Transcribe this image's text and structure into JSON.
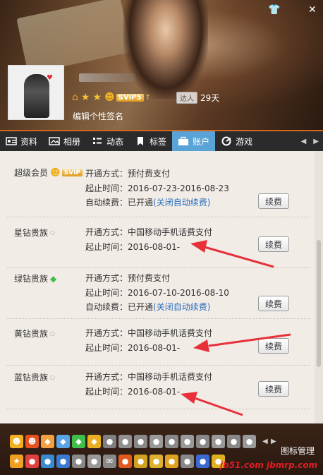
{
  "window": {
    "skin_icon": "shirt-icon",
    "close_icon": "close-icon"
  },
  "profile": {
    "days": "29天",
    "daren_label": "达人",
    "signature": "编辑个性签名",
    "svip_label": "SVIP5",
    "avatar_heart": "♥"
  },
  "tabs": [
    {
      "label": "资料",
      "icon": "id-card-icon"
    },
    {
      "label": "相册",
      "icon": "photo-album-icon"
    },
    {
      "label": "动态",
      "icon": "feed-icon"
    },
    {
      "label": "标签",
      "icon": "bookmark-icon"
    },
    {
      "label": "账户",
      "icon": "briefcase-icon",
      "active": true
    },
    {
      "label": "游戏",
      "icon": "game-icon"
    }
  ],
  "services": [
    {
      "name": "超级会员",
      "badge": "SVIP",
      "lines": [
        {
          "key": "开通方式：",
          "value": "预付费支付"
        },
        {
          "key": "起止时间：",
          "value": "2016-07-23-2016-08-23"
        },
        {
          "key": "自动续费：",
          "value": "已开通",
          "link": "(关闭自动续费)"
        }
      ],
      "button": "续费"
    },
    {
      "name": "星钻贵族",
      "lines": [
        {
          "key": "开通方式：",
          "value": "中国移动手机话费支付"
        },
        {
          "key": "起止时间：",
          "value": "2016-08-01-"
        }
      ],
      "button": "续费"
    },
    {
      "name": "绿钻贵族",
      "lines": [
        {
          "key": "开通方式：",
          "value": "预付费支付"
        },
        {
          "key": "起止时间：",
          "value": "2016-07-10-2016-08-10"
        },
        {
          "key": "自动续费：",
          "value": "已开通",
          "link": "(关闭自动续费)"
        }
      ],
      "button": "续费"
    },
    {
      "name": "黄钻贵族",
      "lines": [
        {
          "key": "开通方式：",
          "value": "中国移动手机话费支付"
        },
        {
          "key": "起止时间：",
          "value": "2016-08-01-"
        }
      ],
      "button": "续费"
    },
    {
      "name": "蓝钻贵族",
      "lines": [
        {
          "key": "开通方式：",
          "value": "中国移动手机话费支付"
        },
        {
          "key": "起止时间：",
          "value": "2016-08-01-"
        }
      ],
      "button": "续费"
    }
  ],
  "icon_manager": "图标管理",
  "watermarks": [
    "jb51.com",
    "jbmrp.com"
  ],
  "colors": {
    "accent": "#5aa3d6",
    "link": "#2a6fbf",
    "arrow": "#e8303a",
    "tab_border": "#d2691e"
  }
}
